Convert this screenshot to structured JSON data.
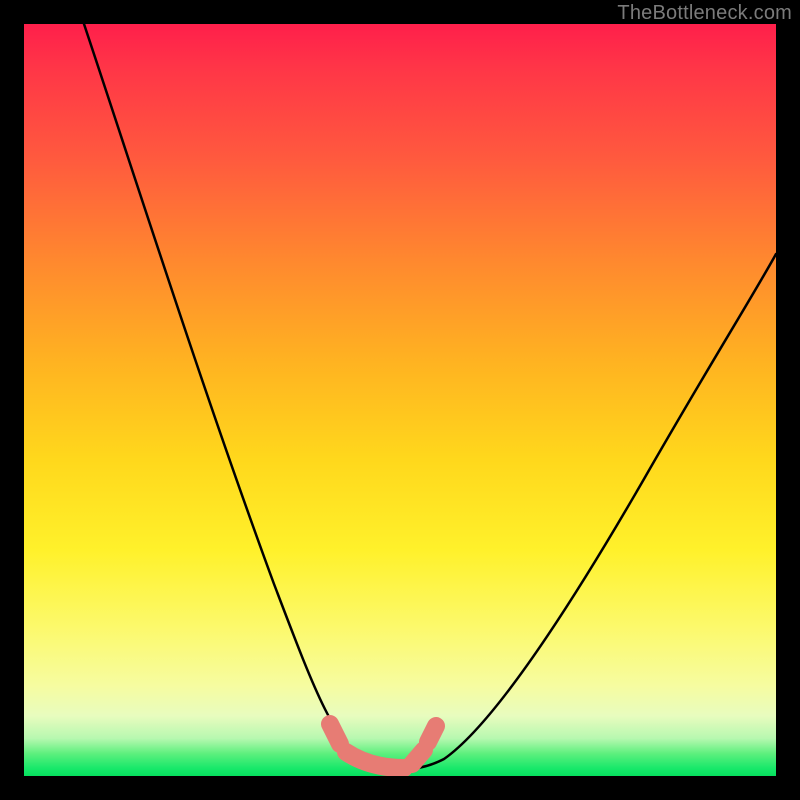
{
  "watermark": {
    "text": "TheBottleneck.com"
  },
  "chart_data": {
    "type": "line",
    "title": "",
    "xlabel": "",
    "ylabel": "",
    "xlim": [
      0,
      100
    ],
    "ylim": [
      0,
      100
    ],
    "grid": false,
    "legend": false,
    "series": [
      {
        "name": "bottleneck-curve",
        "color": "#000000",
        "x": [
          8,
          12,
          16,
          20,
          24,
          28,
          32,
          36,
          38,
          40,
          42,
          44,
          46,
          48,
          50,
          52,
          55,
          60,
          65,
          70,
          75,
          80,
          85,
          90,
          95,
          100
        ],
        "y": [
          100,
          90,
          80,
          70,
          60,
          50,
          40,
          28,
          22,
          15,
          9,
          4,
          1,
          0,
          0,
          1,
          3,
          8,
          14,
          21,
          28,
          35,
          42,
          49,
          55,
          61
        ]
      }
    ],
    "optimal_zone": {
      "name": "optimal-range-marker",
      "color": "#e77c74",
      "x": [
        41,
        43,
        45,
        47,
        49,
        51,
        53
      ],
      "y": [
        6,
        3,
        1,
        0,
        0,
        2,
        5
      ]
    },
    "background_gradient": {
      "top": "#ff1f4b",
      "mid": "#ffe92a",
      "bottom": "#06e05e"
    }
  }
}
